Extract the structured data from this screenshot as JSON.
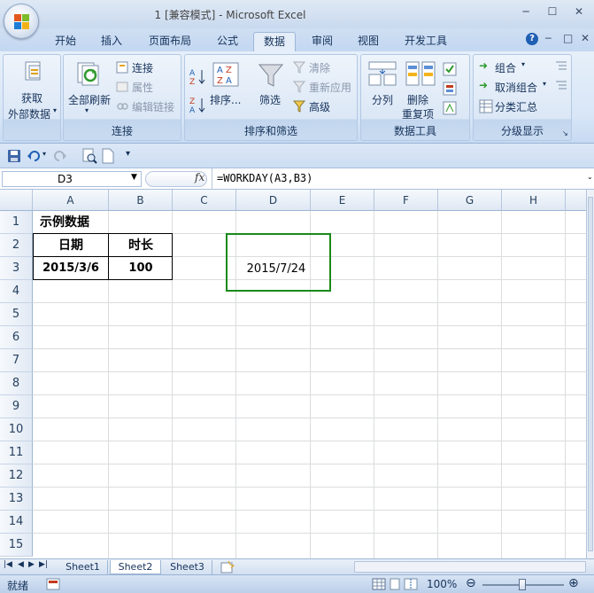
{
  "window": {
    "title": "1  [兼容模式] - Microsoft Excel",
    "minimize": "─",
    "maximize": "☐",
    "close": "✕"
  },
  "tabs": [
    "开始",
    "插入",
    "页面布局",
    "公式",
    "数据",
    "审阅",
    "视图",
    "开发工具"
  ],
  "active_tab": "数据",
  "ribbon_controls": {
    "help": "?",
    "minimize": "─",
    "restore": "□",
    "close": "✕"
  },
  "ribbon": {
    "get_external": {
      "line1": "获取",
      "line2": "外部数据"
    },
    "connections": {
      "refresh_all": "全部刷新",
      "connections": "连接",
      "properties": "属性",
      "edit_links": "编辑链接",
      "title": "连接"
    },
    "sort_filter": {
      "sort": "排序...",
      "filter": "筛选",
      "clear": "清除",
      "reapply": "重新应用",
      "advanced": "高级",
      "title": "排序和筛选"
    },
    "data_tools": {
      "text_to_columns": "分列",
      "remove_dup_1": "删除",
      "remove_dup_2": "重复项",
      "title": "数据工具"
    },
    "outline": {
      "group": "组合",
      "ungroup": "取消组合",
      "subtotal": "分类汇总",
      "title": "分级显示"
    }
  },
  "formula_bar": {
    "name_box": "D3",
    "fx": "fx",
    "formula": "=WORKDAY(A3,B3)"
  },
  "columns": [
    "A",
    "B",
    "C",
    "D",
    "E",
    "F",
    "G",
    "H"
  ],
  "rows": [
    "1",
    "2",
    "3",
    "4",
    "5",
    "6",
    "7",
    "8",
    "9",
    "10",
    "11",
    "12",
    "13",
    "14",
    "15"
  ],
  "cells": {
    "A1": "示例数据",
    "A2": "日期",
    "B2": "时长",
    "A3": "2015/3/6",
    "B3": "100",
    "D3": "2015/7/24"
  },
  "highlight_color": "#1a8a1a",
  "sheets": [
    "Sheet1",
    "Sheet2",
    "Sheet3"
  ],
  "active_sheet": "Sheet2",
  "status": {
    "ready": "就绪",
    "zoom": "100%"
  }
}
